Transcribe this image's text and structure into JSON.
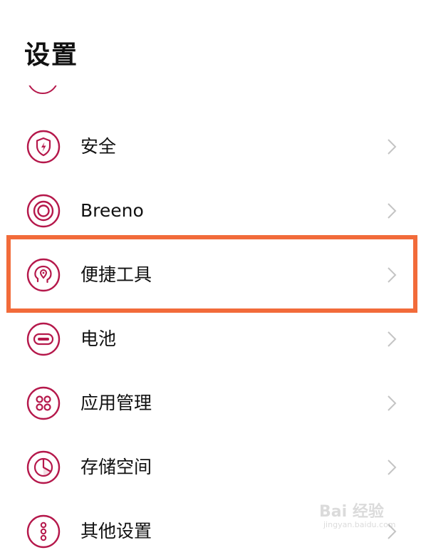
{
  "header": {
    "title": "设置"
  },
  "theme": {
    "icon_color": "#b5184b",
    "chevron_color": "#c4c4c4",
    "highlight_color": "#f26b3a"
  },
  "settings_items": [
    {
      "label": "安全",
      "icon": "shield-lightning-icon"
    },
    {
      "label": "Breeno",
      "icon": "breeno-ring-icon"
    },
    {
      "label": "便捷工具",
      "icon": "head-pin-icon",
      "highlighted": true
    },
    {
      "label": "电池",
      "icon": "battery-icon"
    },
    {
      "label": "应用管理",
      "icon": "app-grid-icon"
    },
    {
      "label": "存储空间",
      "icon": "pie-storage-icon"
    },
    {
      "label": "其他设置",
      "icon": "more-dots-icon"
    }
  ],
  "watermark": {
    "text": "Bai 经验",
    "subtext": "jingyan.baidu.com"
  }
}
